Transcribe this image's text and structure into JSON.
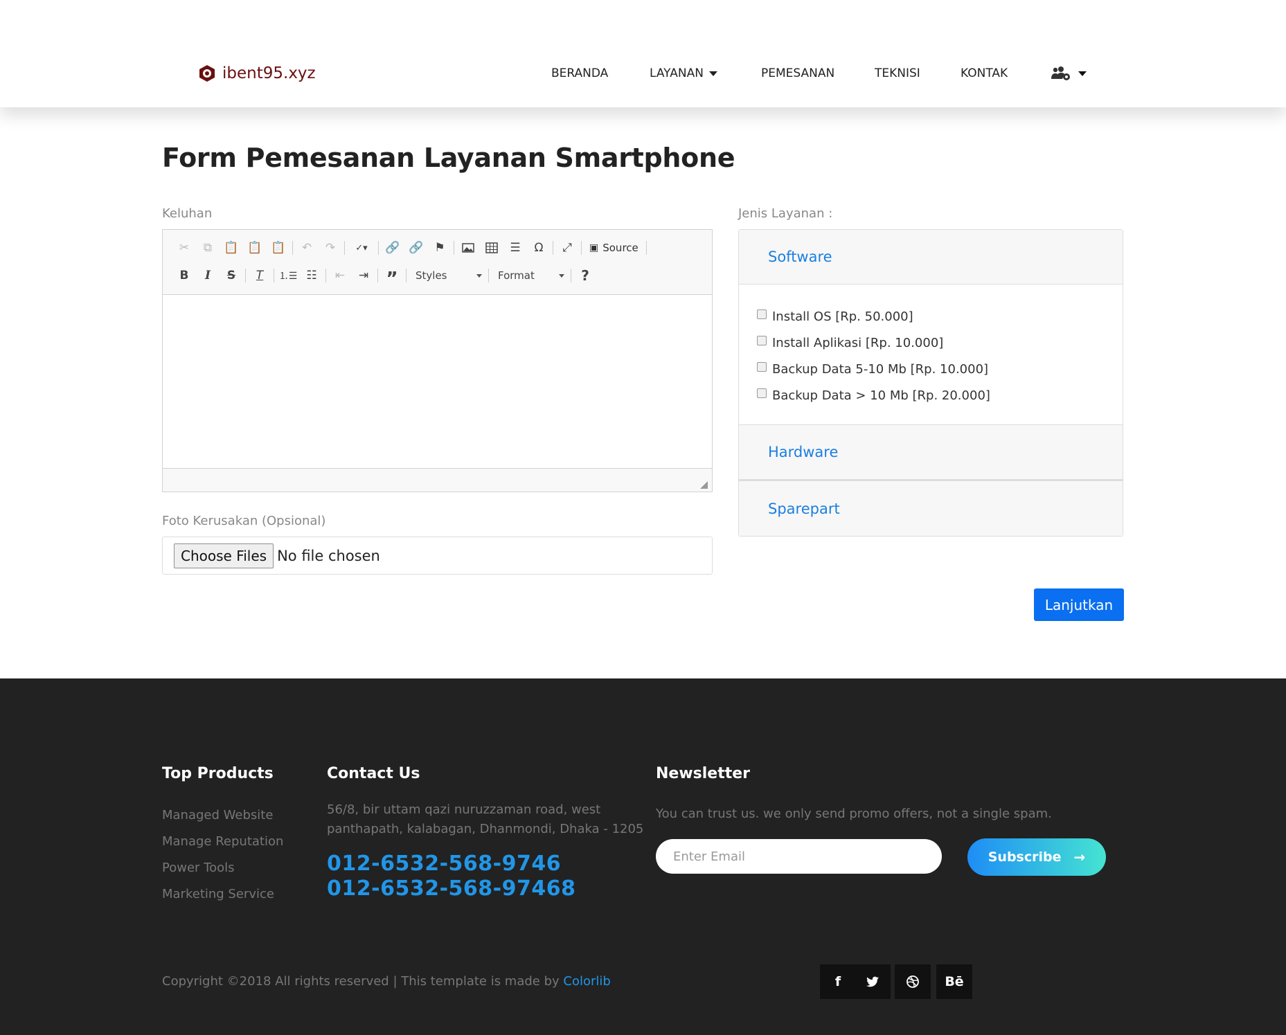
{
  "site": {
    "logo_text": "ibent95.xyz"
  },
  "nav": {
    "items": [
      "BERANDA",
      "LAYANAN",
      "PEMESANAN",
      "TEKNISI",
      "KONTAK"
    ],
    "user_menu_icon": "users-cog-icon"
  },
  "page": {
    "title": "Form Pemesanan Layanan Smartphone"
  },
  "form": {
    "keluhan_label": "Keluhan",
    "editor": {
      "source_label": "Source",
      "styles_combo": "Styles",
      "format_combo": "Format",
      "help_label": "?"
    },
    "foto_label": "Foto Kerusakan (Opsional)",
    "file_button": "Choose Files",
    "file_status": "No file chosen",
    "jenis_label": "Jenis Layanan :",
    "accordion": [
      {
        "title": "Software",
        "expanded": true,
        "options": [
          "Install OS [Rp. 50.000]",
          "Install Aplikasi [Rp. 10.000]",
          "Backup Data 5-10 Mb [Rp. 10.000]",
          "Backup Data > 10 Mb [Rp. 20.000]"
        ]
      },
      {
        "title": "Hardware",
        "expanded": false
      },
      {
        "title": "Sparepart",
        "expanded": false
      }
    ],
    "submit_label": "Lanjutkan"
  },
  "footer": {
    "products": {
      "heading": "Top Products",
      "links": [
        "Managed Website",
        "Manage Reputation",
        "Power Tools",
        "Marketing Service"
      ]
    },
    "contact": {
      "heading": "Contact Us",
      "address_line1": "56/8, bir uttam qazi nuruzzaman road, west",
      "address_line2": "panthapath, kalabagan, Dhanmondi, Dhaka - 1205",
      "phone1": "012-6532-568-9746",
      "phone2": "012-6532-568-97468"
    },
    "newsletter": {
      "heading": "Newsletter",
      "text": "You can trust us. we only send promo offers, not a single spam.",
      "email_placeholder": "Enter Email",
      "subscribe_label": "Subscribe"
    },
    "copyright_text": "Copyright ©2018 All rights reserved | This template is made by ",
    "copyright_link": "Colorlib",
    "social": [
      "facebook-icon",
      "twitter-icon",
      "dribbble-icon",
      "behance-icon"
    ],
    "behance_label": "Bē"
  },
  "colors": {
    "accent": "#0a6ff0",
    "link": "#1a7fe0",
    "footer_bg": "#222222",
    "phone": "#2196e8",
    "logo": "#6a1010"
  }
}
